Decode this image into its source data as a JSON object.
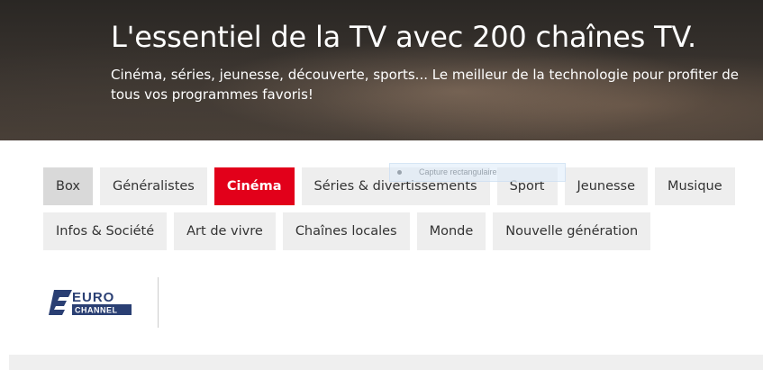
{
  "hero": {
    "title": "L'essentiel de la TV avec 200 chaînes TV.",
    "subtitle": "Cinéma, séries, jeunesse, découverte, sports... Le meilleur de la technologie pour profiter de tous vos programmes favoris!"
  },
  "categories": {
    "row1": [
      "Box",
      "Généralistes",
      "Cinéma",
      "Séries & divertissements",
      "Sport",
      "Jeunesse",
      "Musique"
    ],
    "row2": [
      "Infos & Société",
      "Art de vivre",
      "Chaînes locales",
      "Monde",
      "Nouvelle génération"
    ],
    "active": "Cinéma"
  },
  "overlay": {
    "capture_label": "Capture rectangulaire"
  },
  "channels": [
    {
      "name": "EURO CHANNEL",
      "logo_line1": "EURO",
      "logo_line2": "CHANNEL"
    }
  ],
  "colors": {
    "accent": "#e2001a",
    "tab_bg": "#eeeeee",
    "tab_selected_bg": "#d9d9d9",
    "logo_blue": "#2a3f73"
  }
}
